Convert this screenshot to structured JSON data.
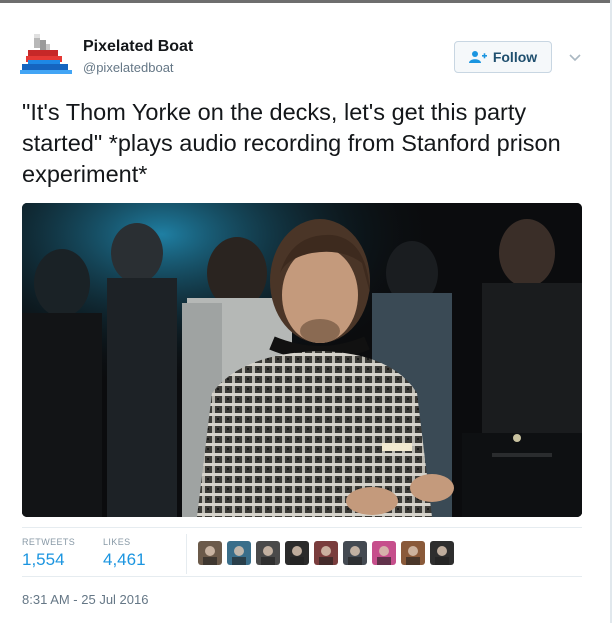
{
  "user": {
    "display_name": "Pixelated Boat",
    "handle": "@pixelatedboat"
  },
  "follow_button": {
    "label": "Follow"
  },
  "tweet": {
    "text": "\"It's Thom Yorke on the decks, let's get this party started\" *plays audio recording from Stanford prison experiment*"
  },
  "stats": {
    "retweets_label": "RETWEETS",
    "retweets_value": "1,554",
    "likes_label": "LIKES",
    "likes_value": "4,461"
  },
  "likers": [
    {
      "color": "#6b5a4a"
    },
    {
      "color": "#3a6e8a"
    },
    {
      "color": "#4a4a4a"
    },
    {
      "color": "#2b2b2b"
    },
    {
      "color": "#7a3d3d"
    },
    {
      "color": "#444a52"
    },
    {
      "color": "#c64f8c"
    },
    {
      "color": "#8a5a3a"
    },
    {
      "color": "#2e2e2e"
    }
  ],
  "timestamp": "8:31 AM - 25 Jul 2016",
  "colors": {
    "link": "#1b95e0",
    "muted": "#657786",
    "text": "#14171a"
  }
}
